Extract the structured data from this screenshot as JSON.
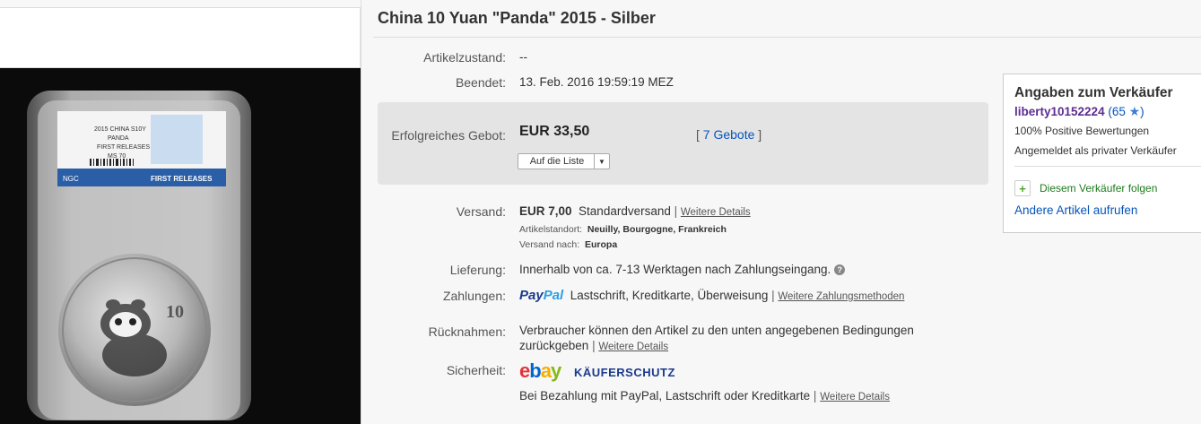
{
  "item": {
    "title": "China 10 Yuan \"Panda\" 2015 - Silber"
  },
  "details": {
    "condition_label": "Artikelzustand:",
    "condition_value": "--",
    "ended_label": "Beendet:",
    "ended_value": "13. Feb. 2016  19:59:19 MEZ"
  },
  "bid": {
    "label": "Erfolgreiches Gebot:",
    "amount": "EUR 33,50",
    "bids_open": "[ ",
    "bids_link": "7 Gebote",
    "bids_close": " ]",
    "watch_label": "Auf die Liste",
    "watch_arrow": "▼"
  },
  "shipping": {
    "label": "Versand:",
    "price": "EUR 7,00",
    "method": "Standardversand",
    "sep": " | ",
    "details_link": "Weitere Details",
    "location_label": "Artikelstandort:",
    "location_value": "Neuilly, Bourgogne, Frankreich",
    "ships_to_label": "Versand nach:",
    "ships_to_value": "Europa"
  },
  "delivery": {
    "label": "Lieferung:",
    "value": "Innerhalb von ca. 7-13 Werktagen nach Zahlungseingang.",
    "help_icon": "?"
  },
  "payments": {
    "label": "Zahlungen:",
    "paypal_1": "Pay",
    "paypal_2": "Pal",
    "methods": "Lastschrift,  Kreditkarte,  Überweisung",
    "sep": " | ",
    "more_link": "Weitere Zahlungsmethoden"
  },
  "returns": {
    "label": "Rücknahmen:",
    "line1": "Verbraucher können den Artikel zu den unten angegebenen Bedingungen",
    "line2": "zurückgeben",
    "sep": " | ",
    "details_link": "Weitere Details"
  },
  "security": {
    "label": "Sicherheit:",
    "logo_e": "e",
    "logo_b": "b",
    "logo_a": "a",
    "logo_y": "y",
    "kaeuferschutz": "KÄUFERSCHUTZ",
    "text": "Bei Bezahlung mit PayPal, Lastschrift oder Kreditkarte",
    "sep": " | ",
    "details_link": "Weitere Details"
  },
  "seller": {
    "heading": "Angaben zum Verkäufer",
    "username": "liberty10152224",
    "score_open": " (65 ",
    "score_close": ")",
    "positive": "100% Positive Bewertungen",
    "registered": "Angemeldet als privater Verkäufer",
    "follow": "Diesem Verkäufer folgen",
    "other_items": "Andere Artikel aufrufen"
  },
  "photo": {
    "slab_line1": "2015 CHINA S10Y",
    "slab_line2": "PANDA",
    "slab_line3": "FIRST RELEASES",
    "slab_line4": "MS 70",
    "slab_band_left": "NGC",
    "slab_band_right": "FIRST RELEASES",
    "coin_value": "10"
  },
  "colors": {
    "link": "#0654ba",
    "seller_name": "#5c2d91",
    "follow_green": "#1e7a1e"
  }
}
